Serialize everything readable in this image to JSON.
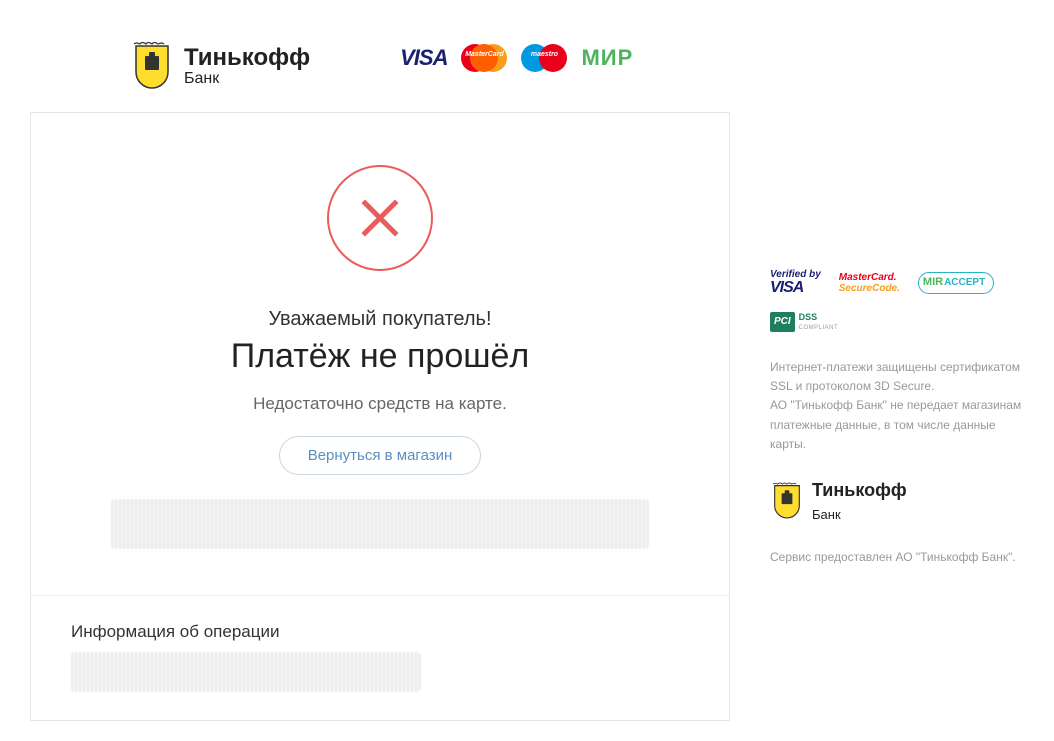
{
  "header": {
    "bank_name": "Тинькофф",
    "bank_sub": "Банк",
    "payment_systems": [
      "VISA",
      "MasterCard",
      "Maestro",
      "МИР"
    ]
  },
  "result": {
    "greeting": "Уважаемый покупатель!",
    "title": "Платёж не прошёл",
    "reason": "Недостаточно средств на карте.",
    "back_button": "Вернуться в магазин"
  },
  "operation": {
    "section_label": "Информация об операции"
  },
  "sidebar": {
    "security_badges": [
      "Verified by VISA",
      "MasterCard SecureCode",
      "MIR ACCEPT",
      "PCI DSS compliant"
    ],
    "security_text": "Интернет-платежи защищены сертификатом SSL и протоколом 3D Secure.\nАО \"Тинькофф Банк\" не передает магазинам платежные данные, в том числе данные карты.",
    "bank_name": "Тинькофф",
    "bank_sub": "Банк",
    "provider_text": "Сервис предоставлен АО \"Тинькофф Банк\"."
  }
}
